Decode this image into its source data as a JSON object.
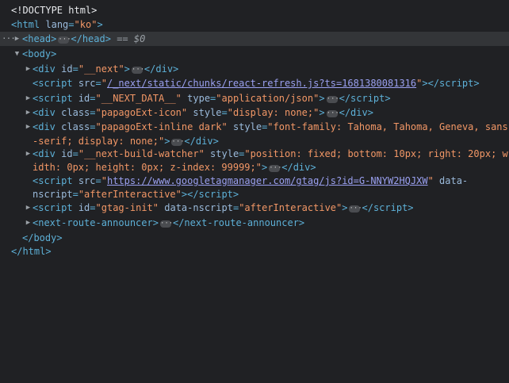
{
  "lines": {
    "doctype": "<!DOCTYPE html>",
    "html_open": {
      "tag": "html",
      "attr": "lang",
      "val": "ko"
    },
    "head": {
      "open": "head",
      "close": "/head",
      "marker": "== $0"
    },
    "body_open": "body",
    "next_div": {
      "tag": "div",
      "attr": "id",
      "val": "__next",
      "close": "/div"
    },
    "refresh_script": {
      "tag": "script",
      "attr": "src",
      "val": "/_next/static/chunks/react-refresh.js?ts=1681380081316",
      "close": "/script"
    },
    "next_data": {
      "tag": "script",
      "attr1": "id",
      "val1": "__NEXT_DATA__",
      "attr2": "type",
      "val2": "application/json",
      "close": "/script"
    },
    "papago_icon": {
      "tag": "div",
      "attr1": "class",
      "val1": "papagoExt-icon",
      "attr2": "style",
      "val2": "display: none;",
      "close": "/div"
    },
    "papago_inline": {
      "tag": "div",
      "attr1": "class",
      "val1": "papagoExt-inline dark",
      "attr2": "style",
      "val2a": "font-family: Tahoma, Tahoma, Geneva, sans",
      "val2b": "-serif; display: none;",
      "close": "/div"
    },
    "build_watcher": {
      "tag": "div",
      "attr1": "id",
      "val1": "__next-build-watcher",
      "attr2": "style",
      "val2a": "position: fixed; bottom: 10px; right: 20px; w",
      "val2b": "idth: 0px; height: 0px; z-index: 99999;",
      "close": "/div"
    },
    "gtm_script": {
      "tag": "script",
      "attr1": "src",
      "val1": "https://www.googletagmanager.com/gtag/js?id=G-NNYW2HQJXW",
      "attr2a": "data-",
      "attr2b": "nscript",
      "val2": "afterInteractive",
      "close": "/script"
    },
    "gtag_init": {
      "tag": "script",
      "attr1": "id",
      "val1": "gtag-init",
      "attr2": "data-nscript",
      "val2": "afterInteractive",
      "close": "/script"
    },
    "route_announcer": {
      "tag": "next-route-announcer",
      "close": "/next-route-announcer"
    },
    "body_close": "/body",
    "html_close": "/html"
  },
  "colors": {
    "background": "#202124",
    "tag": "#5db0d7",
    "attribute": "#9bbbdc",
    "value": "#f29766",
    "selected_row": "#333538"
  },
  "icons": {
    "expand": "triangle-right-icon",
    "collapse": "triangle-down-icon",
    "ellipsis": "ellipsis-badge-icon"
  }
}
